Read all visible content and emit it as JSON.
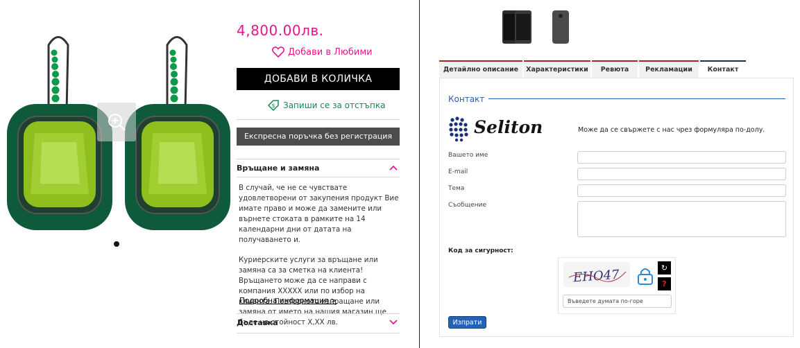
{
  "product": {
    "price": "4,800.00лв.",
    "add_favorites": "Добави в Любими",
    "add_to_cart": "ДОБАВИ В КОЛИЧКА",
    "discount_signup": "Запиши се за отстъпка",
    "express_order": "Експресна поръчка без регистрация"
  },
  "accordion": {
    "returns_title": "Връщане и замяна",
    "returns_p1": "В случай, че не се чувствате удовлетворени от закупения продукт Вие имате право и може да замените или върнете стоката в рамките на 14 календарни дни от датата на получаването и.",
    "returns_p2": "Куриерските услуги за връщане или замяна са за сметка на клиента! Връщането може да се направи с компания XXXXX или по избор на клиента. Повторното изпращане или замяна от името на нашия магазин ще бъде на стойност X,XX лв.",
    "more_info": "Подробна информация >",
    "delivery_title": "Доставка"
  },
  "tabs": [
    {
      "label": "Детайлно описание"
    },
    {
      "label": "Характеристики"
    },
    {
      "label": "Ревюта"
    },
    {
      "label": "Рекламации"
    },
    {
      "label": "Контакт"
    }
  ],
  "contact": {
    "title": "Контакт",
    "logo_text": "Seliton",
    "intro": "Може да се свържете с нас чрез формуляра по-долу.",
    "name_label": "Вашето име",
    "email_label": "E-mail",
    "subject_label": "Тема",
    "message_label": "Съобщение",
    "security_label": "Код за сигурност:",
    "captcha_text": "EHO47",
    "captcha_placeholder": "Въведете думата по-горе",
    "send_label": "Изпрати"
  },
  "colors": {
    "accent_pink": "#e4168c",
    "accent_green": "#118a4e",
    "link_blue": "#2a5db0",
    "tab_red": "#b02020"
  }
}
